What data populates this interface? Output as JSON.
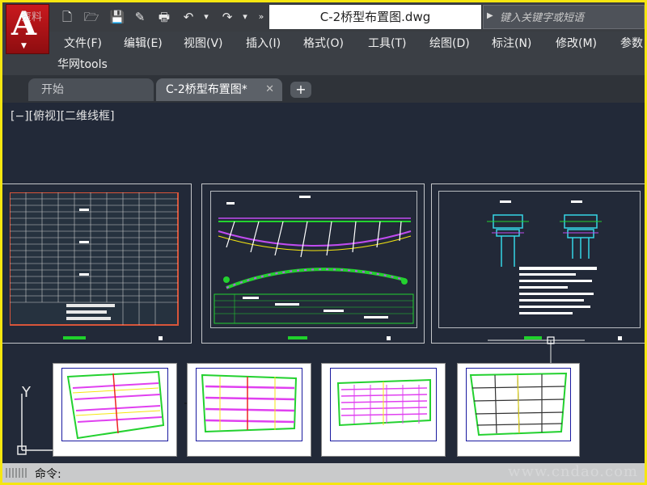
{
  "app": {
    "logo_letter": "A",
    "watermark_text": "资料",
    "doc_title": "C-2桥型布置图.dwg",
    "colors": {
      "accent": "#f5e610",
      "logo": "#c9191e",
      "canvas": "#222938"
    }
  },
  "quick_access": [
    {
      "name": "new-icon",
      "glyph": "🗋"
    },
    {
      "name": "open-icon",
      "glyph": "🗁"
    },
    {
      "name": "save-icon",
      "glyph": "💾"
    },
    {
      "name": "save-as-icon",
      "glyph": "✎"
    },
    {
      "name": "print-icon",
      "glyph": "🖶"
    },
    {
      "name": "undo-icon",
      "glyph": "↶"
    },
    {
      "name": "undo-dropdown-icon",
      "glyph": "▾"
    },
    {
      "name": "redo-icon",
      "glyph": "↷"
    },
    {
      "name": "redo-dropdown-icon",
      "glyph": "▾"
    },
    {
      "name": "more-icon",
      "glyph": "»"
    }
  ],
  "search": {
    "placeholder": "键入关键字或短语"
  },
  "menu": {
    "items": [
      "文件(F)",
      "编辑(E)",
      "视图(V)",
      "插入(I)",
      "格式(O)",
      "工具(T)",
      "绘图(D)",
      "标注(N)",
      "修改(M)",
      "参数"
    ],
    "tools": "华网tools"
  },
  "tabs": {
    "start": "开始",
    "drawing": "C-2桥型布置图*",
    "new_tab": "+",
    "close": "✕"
  },
  "viewport": {
    "label": "[−][俯视][二维线框]",
    "ucs_y": "Y"
  },
  "command": {
    "label": "命令:"
  },
  "watermark": "www.cndao.com"
}
